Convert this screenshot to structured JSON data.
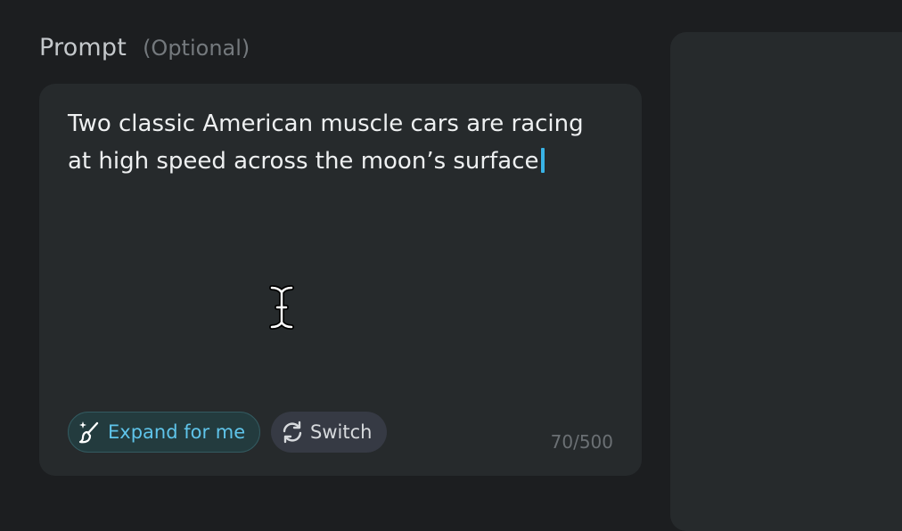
{
  "prompt": {
    "title": "Prompt",
    "optional_label": "(Optional)",
    "text": "Two classic American muscle cars are racing at high speed across the moon’s surface",
    "char_count": "70/500",
    "char_used": 70,
    "char_limit": 500
  },
  "actions": {
    "expand_label": "Expand for me",
    "switch_label": "Switch"
  },
  "icons": {
    "expand": "magic-brush-sparkle-icon",
    "switch": "refresh-icon",
    "cursor": "text-cursor-icon"
  },
  "colors": {
    "background": "#1c1e20",
    "panel": "#262a2c",
    "accent": "#5fc4ea",
    "caret": "#39b3e6"
  }
}
